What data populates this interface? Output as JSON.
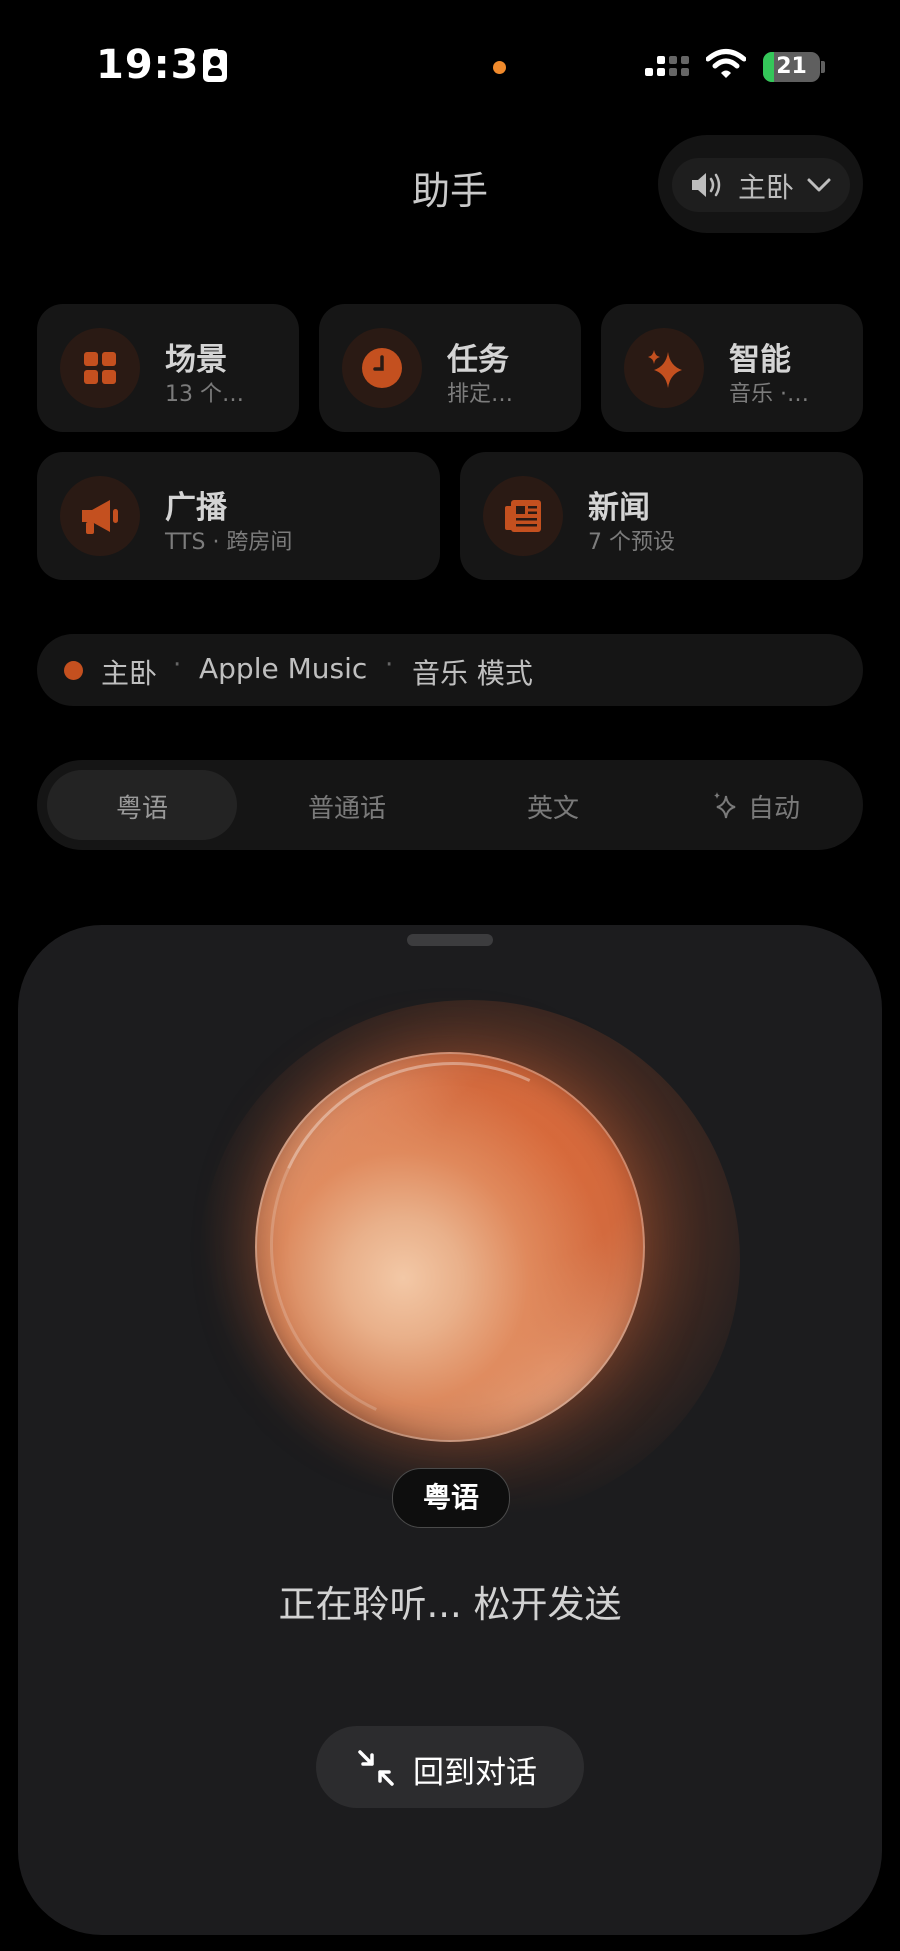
{
  "status_bar": {
    "time": "19:31",
    "battery": "21"
  },
  "header": {
    "title": "助手",
    "room_selector": "主卧"
  },
  "cards": [
    {
      "title": "场景",
      "subtitle": "13 个…",
      "icon": "grid-icon"
    },
    {
      "title": "任务",
      "subtitle": "排定…",
      "icon": "clock-icon"
    },
    {
      "title": "智能",
      "subtitle": "音乐 ·…",
      "icon": "sparkle-icon"
    },
    {
      "title": "广播",
      "subtitle": "TTS · 跨房间",
      "icon": "megaphone-icon"
    },
    {
      "title": "新闻",
      "subtitle": "7 个预设",
      "icon": "newspaper-icon"
    }
  ],
  "now_playing": {
    "room": "主卧",
    "source": "Apple Music",
    "mode": "音乐 模式"
  },
  "language_tabs": {
    "items": [
      "粤语",
      "普通话",
      "英文",
      "自动"
    ],
    "selected": "粤语"
  },
  "listening_sheet": {
    "language_chip": "粤语",
    "status": "正在聆听... 松开发送",
    "back_button": "回到对话"
  },
  "colors": {
    "accent": "#c4501f",
    "background": "#000000",
    "sheet": "#1c1c1e"
  }
}
